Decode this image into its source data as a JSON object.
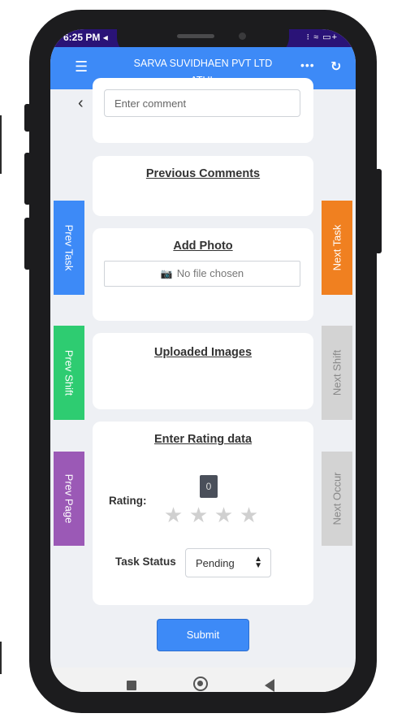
{
  "status_bar": {
    "time": "6:25 PM",
    "time_icon": "navigation-arrow-icon",
    "indicators": "⁝ ≈ ▭+"
  },
  "header": {
    "company": "SARVA SUVIDHAEN PVT LTD",
    "user": "ATUL",
    "menu_icon": "hamburger-menu-icon",
    "more_icon": "more-dots-icon",
    "refresh_icon": "refresh-icon"
  },
  "comment": {
    "placeholder": "Enter comment"
  },
  "sections": {
    "previous_comments": "Previous Comments",
    "add_photo": "Add Photo",
    "uploaded_images": "Uploaded Images",
    "rating": "Enter Rating data"
  },
  "photo": {
    "file_status": "No file chosen"
  },
  "rating": {
    "label": "Rating:",
    "value": "0",
    "stars_filled": 0,
    "stars_total": 4
  },
  "task_status": {
    "label": "Task Status",
    "selected": "Pending"
  },
  "submit_label": "Submit",
  "side_tabs": {
    "prev_task": "Prev Task",
    "prev_shift": "Prev Shift",
    "prev_page": "Prev Page",
    "next_task": "Next Task",
    "next_shift": "Next Shift",
    "next_occur": "Next Occur"
  },
  "colors": {
    "header": "#3d8af7",
    "status_bar": "#2a1377",
    "prev_task": "#3d8af7",
    "prev_shift": "#2ecc71",
    "prev_page": "#9b59b6",
    "next_task": "#f08020",
    "disabled_tab": "#d3d3d3"
  }
}
